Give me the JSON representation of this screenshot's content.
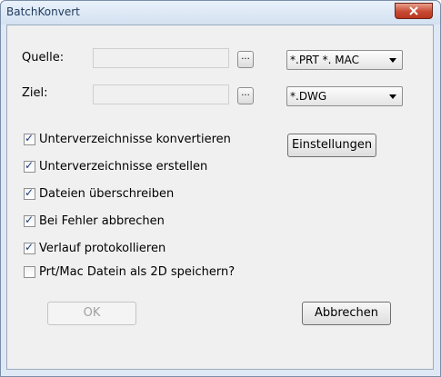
{
  "window": {
    "title": "BatchKonvert"
  },
  "source": {
    "label": "Quelle:",
    "browse_label": "...",
    "filter_value": "*.PRT *. MAC"
  },
  "target": {
    "label": "Ziel:",
    "browse_label": "...",
    "format_value": "*.DWG"
  },
  "settings_button": "Einstellungen",
  "options": [
    {
      "label": "Unterverzeichnisse konvertieren",
      "checked": true
    },
    {
      "label": "Unterverzeichnisse erstellen",
      "checked": true
    },
    {
      "label": "Dateien überschreiben",
      "checked": true
    },
    {
      "label": "Bei Fehler abbrechen",
      "checked": true
    },
    {
      "label": "Verlauf protokollieren",
      "checked": true
    },
    {
      "label": "Prt/Mac Datein als 2D speichern?",
      "checked": false
    }
  ],
  "buttons": {
    "ok": "OK",
    "cancel": "Abbrechen"
  }
}
